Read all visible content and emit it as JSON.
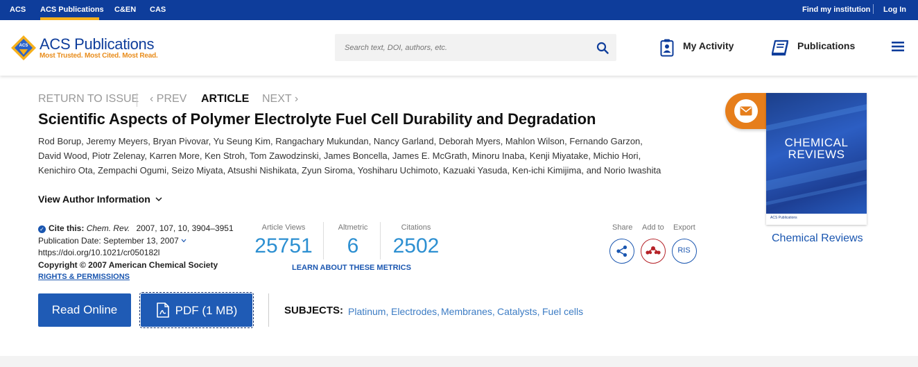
{
  "topbar": {
    "links": [
      "ACS",
      "ACS Publications",
      "C&EN",
      "CAS"
    ],
    "find_institution": "Find my institution",
    "login": "Log In"
  },
  "header": {
    "brand_name": "ACS Publications",
    "brand_tagline": "Most Trusted. Most Cited. Most Read.",
    "search_placeholder": "Search text, DOI, authors, etc.",
    "my_activity": "My Activity",
    "publications": "Publications"
  },
  "article_nav": {
    "return": "RETURN TO ISSUE",
    "prev": "‹ PREV",
    "article": "ARTICLE",
    "next": "NEXT ›"
  },
  "article": {
    "title": "Scientific Aspects of Polymer Electrolyte Fuel Cell Durability and Degradation",
    "authors_line1": "Rod Borup, Jeremy Meyers, Bryan Pivovar, Yu Seung Kim, Rangachary Mukundan, Nancy Garland, Deborah Myers, Mahlon Wilson, Fernando Garzon,",
    "authors_line2": "David Wood, Piotr Zelenay, Karren More, Ken Stroh, Tom Zawodzinski, James Boncella, James E. McGrath, Minoru Inaba, Kenji Miyatake, Michio Hori,",
    "authors_line3": "Kenichiro Ota, Zempachi Ogumi, Seizo Miyata, Atsushi Nishikata, Zyun Siroma, Yoshiharu Uchimoto, Kazuaki Yasuda, Ken-ichi Kimijima, and Norio Iwashita",
    "view_author_info": "View Author Information"
  },
  "cite": {
    "label": "Cite this:",
    "journal": "Chem. Rev.",
    "ref": "2007, 107, 10, 3904–3951",
    "pub_date": "Publication Date: September 13, 2007",
    "doi": "https://doi.org/10.1021/cr050182l",
    "copyright": "Copyright © 2007 American Chemical Society",
    "rights": "RIGHTS & PERMISSIONS"
  },
  "metrics": {
    "views_label": "Article Views",
    "views": "25751",
    "altmetric_label": "Altmetric",
    "altmetric": "6",
    "citations_label": "Citations",
    "citations": "2502",
    "learn": "LEARN ABOUT THESE METRICS"
  },
  "actions": {
    "share": "Share",
    "add_to": "Add to",
    "export": "Export",
    "ris": "RIS"
  },
  "buttons": {
    "read_online": "Read Online",
    "pdf": "PDF (1 MB)"
  },
  "subjects": {
    "label": "SUBJECTS:",
    "items": [
      "Platinum,",
      "Electrodes,",
      "Membranes,",
      "Catalysts,",
      "Fuel cells"
    ]
  },
  "cover": {
    "line1": "CHEMICAL",
    "line2": "REVIEWS",
    "footer": "ACS Publications",
    "journal_link": "Chemical Reviews"
  },
  "colors": {
    "topbar": "#0e3d9b",
    "accent": "#f6b01c",
    "metric": "#2c8fd1",
    "link": "#1a56b0",
    "button": "#1f5bb5",
    "mail": "#e67e1b"
  }
}
